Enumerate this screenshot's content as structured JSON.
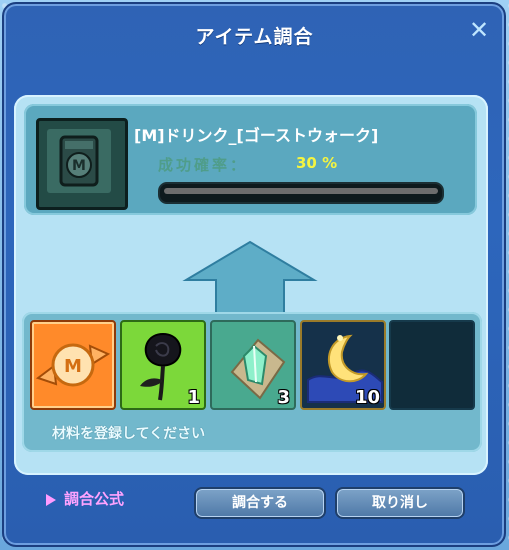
{
  "window": {
    "title": "アイテム調合",
    "close_symbol": "✕"
  },
  "result": {
    "item_name": "[M]ドリンク_[ゴーストウォーク]",
    "success_rate_label": "成功確率：",
    "success_rate_value": "30 %",
    "progress_fraction": 0.0
  },
  "materials": {
    "slots": [
      {
        "icon": "candy-m-icon",
        "quantity": ""
      },
      {
        "icon": "black-rose-icon",
        "quantity": "1"
      },
      {
        "icon": "green-crystal-icon",
        "quantity": "3"
      },
      {
        "icon": "crescent-moon-icon",
        "quantity": "10"
      },
      {
        "icon": "empty-slot",
        "quantity": ""
      }
    ],
    "hint": "材料を登録してください"
  },
  "footer": {
    "formula_label": "調合公式",
    "combine_label": "調合する",
    "cancel_label": "取り消し"
  },
  "colors": {
    "title_text": "#ffffff",
    "rate_value": "#f4f441",
    "formula_text": "#ffa3ff",
    "panel": "#b6e2f4"
  }
}
